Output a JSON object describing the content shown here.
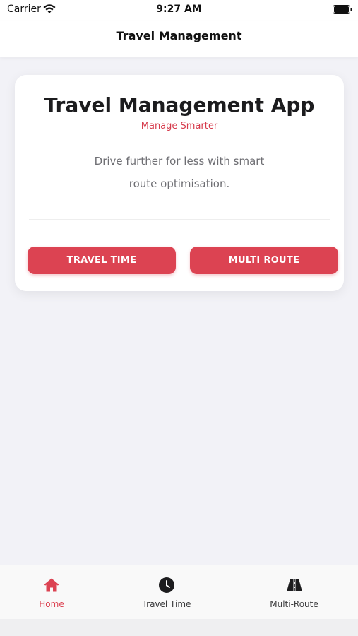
{
  "status_bar": {
    "carrier": "Carrier",
    "time": "9:27 AM"
  },
  "nav": {
    "title": "Travel Management"
  },
  "card": {
    "title": "Travel Management App",
    "subtitle": "Manage Smarter",
    "description_line1": "Drive further for less with smart",
    "description_line2": "route optimisation.",
    "buttons": {
      "travel_time": "TRAVEL TIME",
      "multi_route": "MULTI ROUTE"
    }
  },
  "tabs": [
    {
      "label": "Home",
      "icon": "home-icon",
      "active": true
    },
    {
      "label": "Travel Time",
      "icon": "clock-icon",
      "active": false
    },
    {
      "label": "Multi-Route",
      "icon": "road-icon",
      "active": false
    }
  ],
  "colors": {
    "accent": "#dc4352",
    "background": "#f2f2f7",
    "text": "#1c1c1e"
  }
}
